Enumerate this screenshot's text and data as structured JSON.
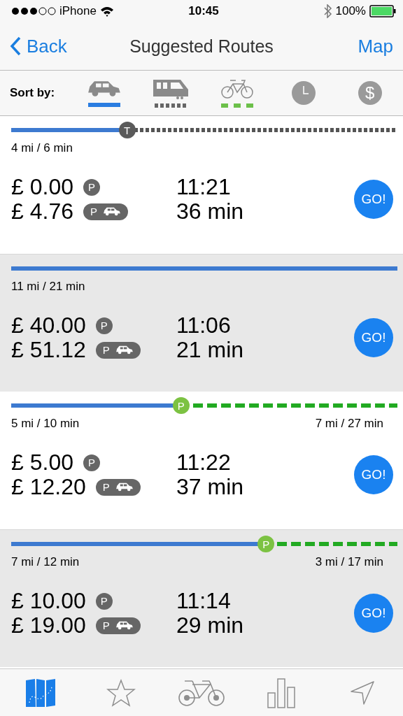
{
  "status_bar": {
    "carrier": "iPhone",
    "time": "10:45",
    "battery": "100%"
  },
  "nav_bar": {
    "back": "Back",
    "title": "Suggested Routes",
    "right": "Map"
  },
  "sort_bar": {
    "label": "Sort by:",
    "options": [
      {
        "kind": "car",
        "color": "#2a7de1"
      },
      {
        "kind": "train",
        "color": "#666666"
      },
      {
        "kind": "bike",
        "color": "#6cc04a"
      },
      {
        "kind": "clock"
      },
      {
        "kind": "price",
        "symbol": "$"
      }
    ]
  },
  "routes": [
    {
      "track": {
        "level": 0.3,
        "rest": {
          "kind": "train"
        },
        "stop": {
          "kind": "transfer",
          "label": "T"
        }
      },
      "leg_labels": [
        "4 mi  / 6 min"
      ],
      "prices": [
        {
          "amount": "£ 0.00",
          "kind": "parking",
          "badge": "P"
        },
        {
          "amount": "£ 4.76",
          "kind": "park_ride",
          "badge": "P"
        }
      ],
      "arrival": "11:21",
      "duration": "36 min",
      "button": "GO!"
    },
    {
      "track": {
        "kind": "direct"
      },
      "leg_labels": [
        "11 mi  / 21 min"
      ],
      "prices": [
        {
          "amount": "£ 40.00",
          "kind": "parking",
          "badge": "P"
        },
        {
          "amount": "£ 51.12",
          "kind": "park_ride",
          "badge": "P"
        }
      ],
      "arrival": "11:06",
      "duration": "21 min",
      "button": "GO!"
    },
    {
      "track": {
        "level": 0.44,
        "rest": {
          "kind": "bike"
        },
        "stop": {
          "kind": "parking",
          "label": "P"
        }
      },
      "leg_labels": [
        "5 mi  / 10 min",
        "7 mi  / 27 min"
      ],
      "prices": [
        {
          "amount": "£ 5.00",
          "kind": "parking",
          "badge": "P"
        },
        {
          "amount": "£ 12.20",
          "kind": "park_ride",
          "badge": "P"
        }
      ],
      "arrival": "11:22",
      "duration": "37 min",
      "button": "GO!"
    },
    {
      "track": {
        "level": 0.66,
        "rest": {
          "kind": "bike"
        },
        "stop": {
          "kind": "parking",
          "label": "P"
        }
      },
      "leg_labels": [
        "7 mi  / 12 min",
        "3 mi  / 17 min"
      ],
      "prices": [
        {
          "amount": "£ 10.00",
          "kind": "parking",
          "badge": "P"
        },
        {
          "amount": "£ 19.00",
          "kind": "park_ride",
          "badge": "P"
        }
      ],
      "arrival": "11:14",
      "duration": "29 min",
      "button": "GO!"
    }
  ],
  "tab_bar": [
    {
      "kind": "map",
      "selected": true
    },
    {
      "kind": "star",
      "selected": false
    },
    {
      "kind": "bike",
      "selected": false
    },
    {
      "kind": "chart",
      "selected": false
    },
    {
      "kind": "location",
      "selected": false
    }
  ]
}
